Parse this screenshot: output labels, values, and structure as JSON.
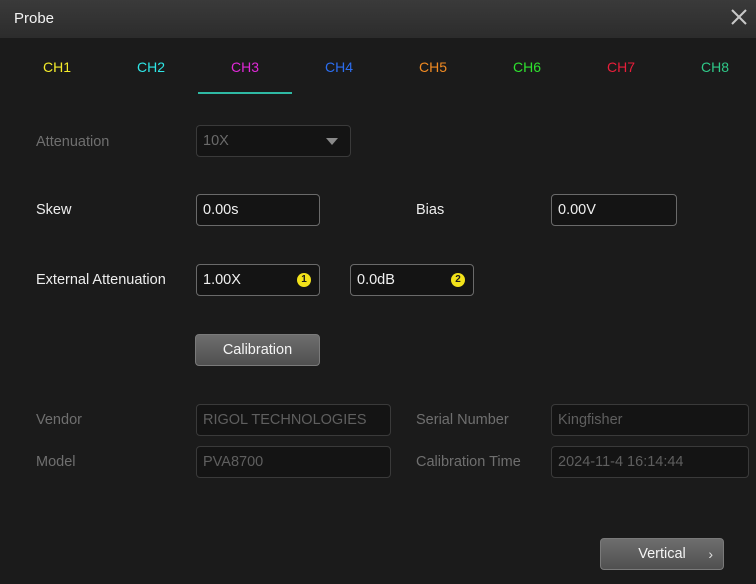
{
  "dialog": {
    "title": "Probe"
  },
  "tabs": [
    {
      "label": "CH1",
      "color": "#f4ec2a"
    },
    {
      "label": "CH2",
      "color": "#2ee6e6"
    },
    {
      "label": "CH3",
      "color": "#e028d8"
    },
    {
      "label": "CH4",
      "color": "#2c6ef0"
    },
    {
      "label": "CH5",
      "color": "#f08a22"
    },
    {
      "label": "CH6",
      "color": "#2ee02e"
    },
    {
      "label": "CH7",
      "color": "#e81e3a"
    },
    {
      "label": "CH8",
      "color": "#2fc888"
    }
  ],
  "selected_tab": "CH3",
  "attenuation": {
    "label": "Attenuation",
    "value": "10X"
  },
  "skew": {
    "label": "Skew",
    "value": "0.00s"
  },
  "bias": {
    "label": "Bias",
    "value": "0.00V"
  },
  "external_attenuation": {
    "label": "External Attenuation",
    "ratio": "1.00X",
    "ratio_badge": "1",
    "db": "0.0dB",
    "db_badge": "2"
  },
  "calibration_button": "Calibration",
  "vendor": {
    "label": "Vendor",
    "value": "RIGOL TECHNOLOGIES"
  },
  "serial_number": {
    "label": "Serial Number",
    "value": "Kingfisher"
  },
  "model": {
    "label": "Model",
    "value": "PVA8700"
  },
  "calibration_time": {
    "label": "Calibration Time",
    "value": "2024-11-4 16:14:44"
  },
  "vertical_button": "Vertical",
  "colors": {
    "accent_underline": "#2fb9a4",
    "badge": "#f2e21a"
  }
}
